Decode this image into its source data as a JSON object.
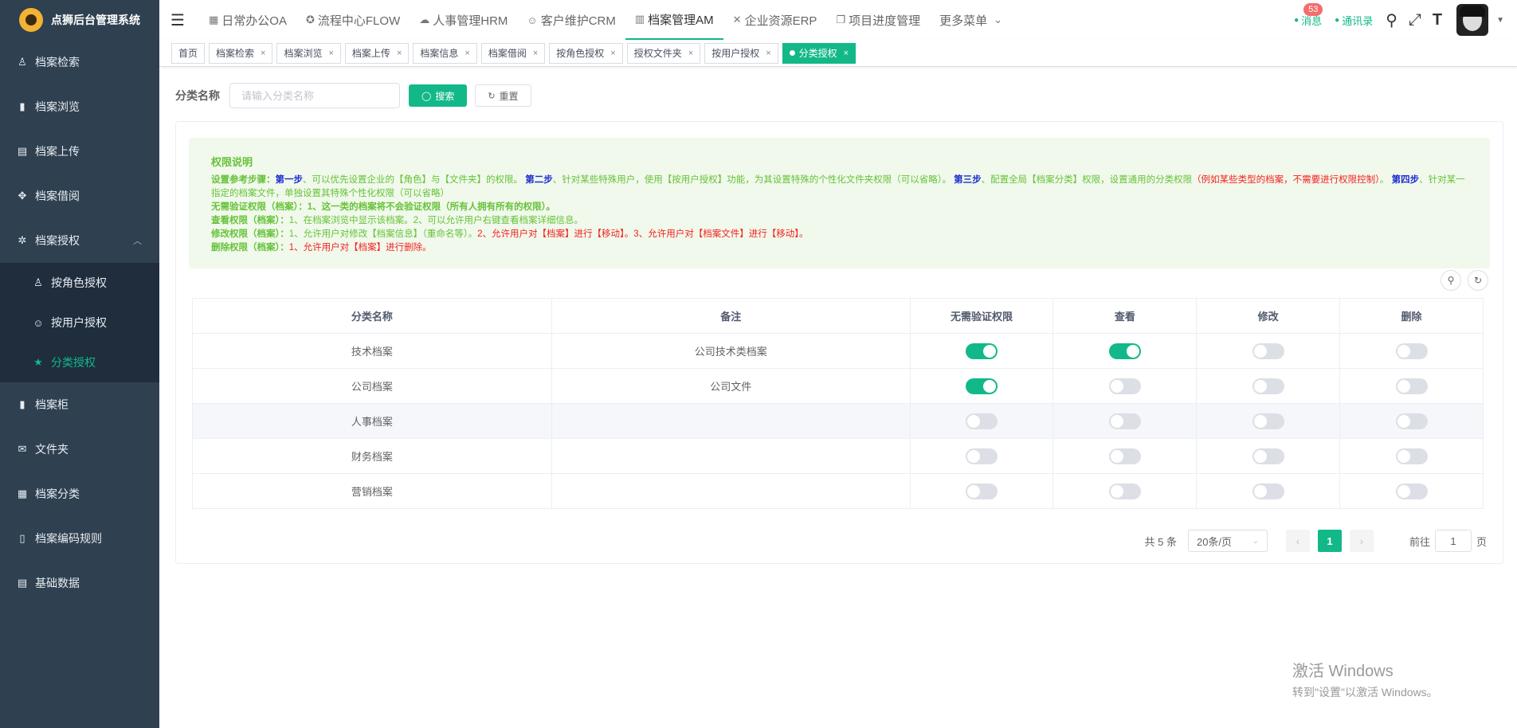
{
  "app": {
    "title": "点狮后台管理系统"
  },
  "sidebar": {
    "items": [
      {
        "label": "档案检索",
        "icon": "person-icon",
        "glyph": "♙"
      },
      {
        "label": "档案浏览",
        "icon": "bar-chart-icon",
        "glyph": "▮"
      },
      {
        "label": "档案上传",
        "icon": "document-icon",
        "glyph": "▤"
      },
      {
        "label": "档案借阅",
        "icon": "move-icon",
        "glyph": "✥"
      },
      {
        "label": "档案授权",
        "icon": "bug-icon",
        "glyph": "✲",
        "expanded": true
      }
    ],
    "sub_items": [
      {
        "label": "按角色授权",
        "icon": "person-icon",
        "glyph": "♙"
      },
      {
        "label": "按用户授权",
        "icon": "users-icon",
        "glyph": "☺"
      },
      {
        "label": "分类授权",
        "icon": "star-icon",
        "glyph": "★",
        "active": true
      }
    ],
    "items_after": [
      {
        "label": "档案柜",
        "icon": "bar-chart-icon",
        "glyph": "▮"
      },
      {
        "label": "文件夹",
        "icon": "mail-icon",
        "glyph": "✉"
      },
      {
        "label": "档案分类",
        "icon": "folder-icon",
        "glyph": "▦"
      },
      {
        "label": "档案编码规则",
        "icon": "code-icon",
        "glyph": "▯"
      },
      {
        "label": "基础数据",
        "icon": "database-icon",
        "glyph": "▤"
      }
    ]
  },
  "header": {
    "nav": [
      {
        "label": "日常办公OA",
        "icon": "grid-icon",
        "glyph": "▦"
      },
      {
        "label": "流程中心FLOW",
        "icon": "flow-icon",
        "glyph": "✪"
      },
      {
        "label": "人事管理HRM",
        "icon": "chat-icon",
        "glyph": "☁"
      },
      {
        "label": "客户维护CRM",
        "icon": "users-icon",
        "glyph": "☺"
      },
      {
        "label": "档案管理AM",
        "icon": "archive-icon",
        "glyph": "▥",
        "active": true
      },
      {
        "label": "企业资源ERP",
        "icon": "compress-icon",
        "glyph": "✕"
      },
      {
        "label": "项目进度管理",
        "icon": "copy-icon",
        "glyph": "❐"
      },
      {
        "label": "更多菜单",
        "icon": "chevron-down-icon",
        "glyph": "⌄"
      }
    ],
    "messages_label": "消息",
    "messages_count": "53",
    "contacts_label": "通讯录"
  },
  "tags": [
    {
      "label": "首页",
      "closable": false
    },
    {
      "label": "档案检索",
      "closable": true
    },
    {
      "label": "档案浏览",
      "closable": true
    },
    {
      "label": "档案上传",
      "closable": true
    },
    {
      "label": "档案信息",
      "closable": true
    },
    {
      "label": "档案借阅",
      "closable": true
    },
    {
      "label": "按角色授权",
      "closable": true
    },
    {
      "label": "授权文件夹",
      "closable": true
    },
    {
      "label": "按用户授权",
      "closable": true
    },
    {
      "label": "分类授权",
      "closable": true,
      "active": true
    }
  ],
  "search": {
    "label": "分类名称",
    "placeholder": "请输入分类名称",
    "search_btn": "搜索",
    "reset_btn": "重置"
  },
  "notice": {
    "title": "权限说明",
    "l1_prefix": "设置参考步骤：",
    "l1_s1": "第一步",
    "l1_t1": "、可以优先设置企业的【角色】与【文件夹】的权限。",
    "l1_s2": "第二步",
    "l1_t2": "、针对某些特殊用户，使用【按用户授权】功能，为其设置特殊的个性化文件夹权限（可以省略）。",
    "l1_s3": "第三步",
    "l1_t3": "、配置全局【档案分类】权限，设置通用的分类权限",
    "l1_red": "（例如某些类型的档案，不需要进行权限控制）",
    "l1_t4": "。",
    "l1_s4": "第四步",
    "l1_t5": "、针对某一指定的档案文件，单独设置其特殊个性化权限（可以省略）",
    "l2_head": "无需验证权限（档案）：",
    "l2_body": "1、这一类的档案将不会验证权限（所有人拥有所有的权限）。",
    "l3_head": "查看权限（档案）：",
    "l3_body": "1、在档案浏览中显示该档案。2、可以允许用户右键查看档案详细信息。",
    "l4_head": "修改权限（档案）：",
    "l4_body1": "1、允许用户对修改【档案信息】（重命名等）。",
    "l4_body2": "2、允许用户对【档案】进行【移动】。3、允许用户对【档案文件】进行【移动】。",
    "l5_head": "删除权限（档案）：",
    "l5_body": "1、允许用户对【档案】进行删除。"
  },
  "table": {
    "headers": [
      "分类名称",
      "备注",
      "无需验证权限",
      "查看",
      "修改",
      "删除"
    ],
    "rows": [
      {
        "name": "技术档案",
        "remark": "公司技术类档案",
        "noauth": true,
        "view": true,
        "edit": false,
        "del": false
      },
      {
        "name": "公司档案",
        "remark": "公司文件",
        "noauth": true,
        "view": false,
        "edit": false,
        "del": false
      },
      {
        "name": "人事档案",
        "remark": "",
        "noauth": false,
        "view": false,
        "edit": false,
        "del": false
      },
      {
        "name": "财务档案",
        "remark": "",
        "noauth": false,
        "view": false,
        "edit": false,
        "del": false
      },
      {
        "name": "营销档案",
        "remark": "",
        "noauth": false,
        "view": false,
        "edit": false,
        "del": false
      }
    ]
  },
  "pagination": {
    "total": "共 5 条",
    "page_size": "20条/页",
    "current": "1",
    "goto_label": "前往",
    "goto_value": "1",
    "page_suffix": "页"
  },
  "watermark": {
    "line1": "激活 Windows",
    "line2": "转到\"设置\"以激活 Windows。"
  },
  "colors": {
    "accent": "#13b889",
    "sidebar": "#2f4050",
    "sidebar_sub": "#1f2d3d",
    "notice_bg": "#f0f9eb",
    "notice_text": "#67c23a"
  }
}
